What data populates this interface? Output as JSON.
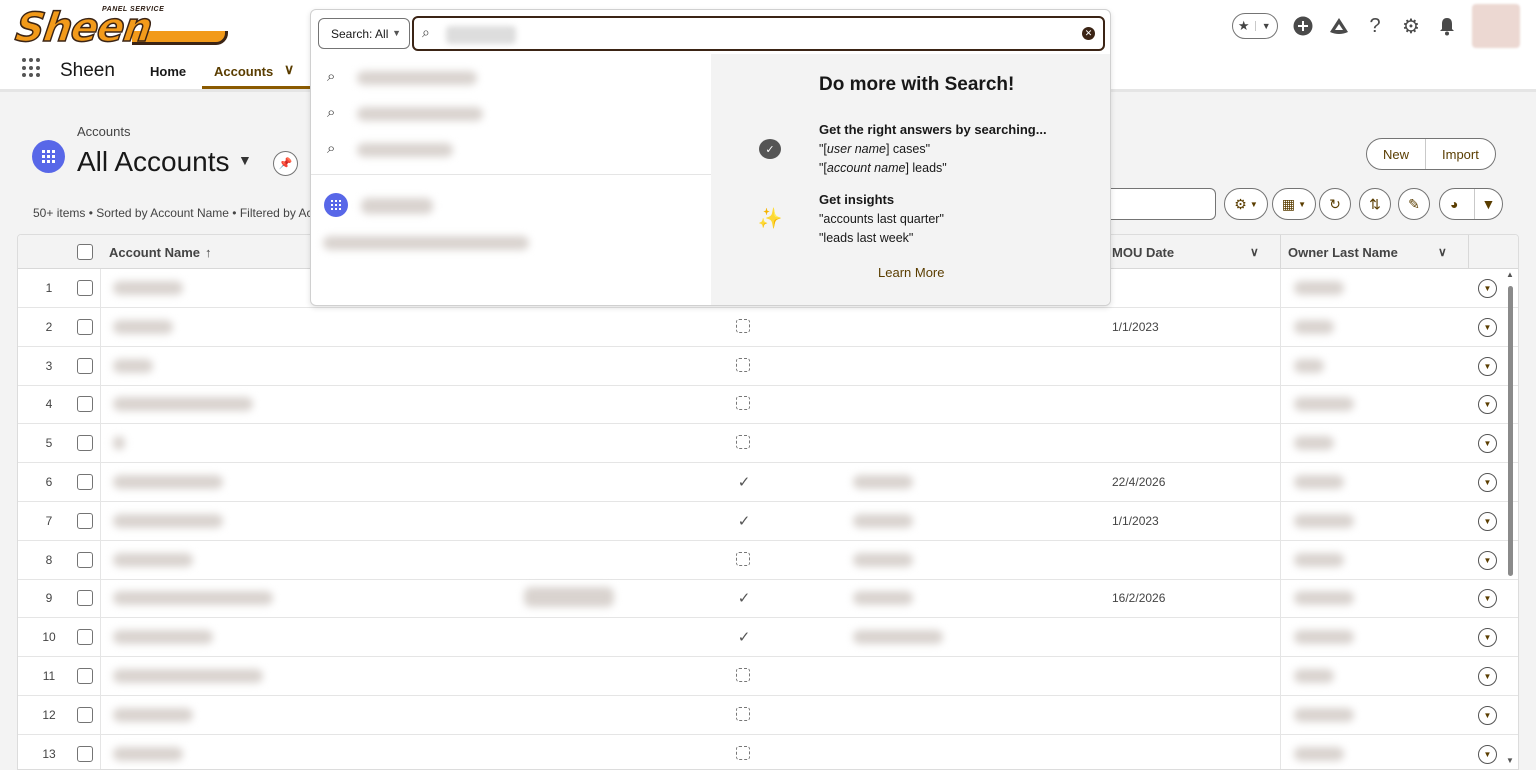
{
  "brand": {
    "logo_small": "PANEL SERVICE",
    "logo_big": "Sheen",
    "app_name": "Sheen"
  },
  "nav": {
    "home": "Home",
    "accounts": "Accounts"
  },
  "page": {
    "breadcrumb": "Accounts",
    "title": "All Accounts",
    "meta": "50+ items • Sorted by Account Name • Filtered by Ac",
    "new_button": "New",
    "import_button": "Import"
  },
  "table": {
    "columns": {
      "account_name": "Account Name",
      "mou_date": "MOU Date",
      "owner_last_name": "Owner Last Name"
    },
    "rows": [
      {
        "num": "1",
        "checked": null,
        "mou_date": ""
      },
      {
        "num": "2",
        "checked": false,
        "mou_date": "1/1/2023"
      },
      {
        "num": "3",
        "checked": false,
        "mou_date": ""
      },
      {
        "num": "4",
        "checked": false,
        "mou_date": ""
      },
      {
        "num": "5",
        "checked": false,
        "mou_date": ""
      },
      {
        "num": "6",
        "checked": true,
        "mou_date": "22/4/2026"
      },
      {
        "num": "7",
        "checked": true,
        "mou_date": "1/1/2023"
      },
      {
        "num": "8",
        "checked": false,
        "mou_date": ""
      },
      {
        "num": "9",
        "checked": true,
        "mou_date": "16/2/2026"
      },
      {
        "num": "10",
        "checked": true,
        "mou_date": ""
      },
      {
        "num": "11",
        "checked": false,
        "mou_date": ""
      },
      {
        "num": "12",
        "checked": false,
        "mou_date": ""
      },
      {
        "num": "13",
        "checked": false,
        "mou_date": ""
      }
    ]
  },
  "search": {
    "scope": "Search: All",
    "input_value": "",
    "help_title": "Do more with Search!",
    "section1_head": "Get the right answers by searching...",
    "section1_line1_pre": "\"[",
    "section1_line1_em": "user name",
    "section1_line1_post": "] cases\"",
    "section1_line2_pre": "\"[",
    "section1_line2_em": "account name",
    "section1_line2_post": "] leads\"",
    "section2_head": "Get insights",
    "section2_line1": "\"accounts last quarter\"",
    "section2_line2": "\"leads last week\"",
    "learn_more": "Learn More"
  },
  "icons": {
    "favorites": "star-icon",
    "add": "plus-circle-icon",
    "trailhead": "trailhead-icon",
    "help": "question-icon",
    "setup": "gear-icon",
    "notifications": "bell-icon"
  },
  "colors": {
    "accent": "#5a3d00",
    "object_icon": "#5867e8",
    "logo_orange": "#f29a1a"
  }
}
